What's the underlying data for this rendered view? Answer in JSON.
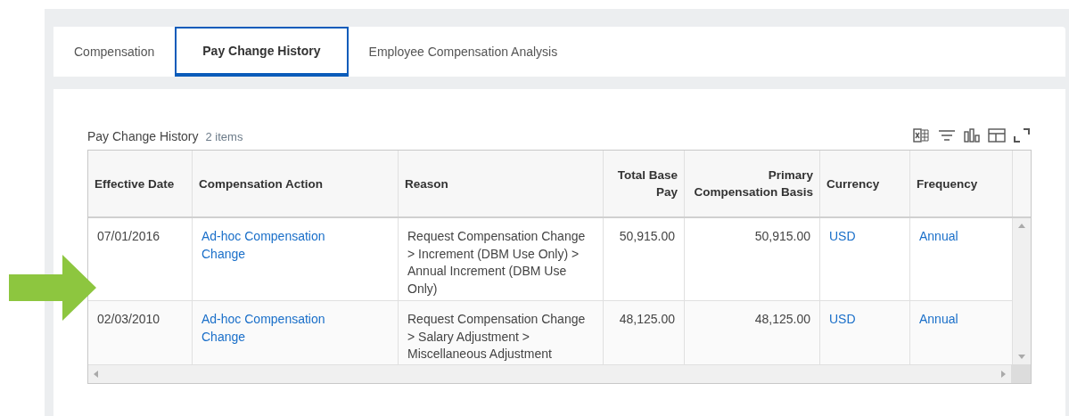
{
  "tabs": [
    {
      "label": "Compensation",
      "selected": false
    },
    {
      "label": "Pay Change History",
      "selected": true
    },
    {
      "label": "Employee Compensation Analysis",
      "selected": false
    }
  ],
  "grid": {
    "title": "Pay Change History",
    "count": "2 items",
    "columns": [
      {
        "label": "Effective Date",
        "kind": "text"
      },
      {
        "label": "Compensation Action",
        "kind": "link"
      },
      {
        "label": "Reason",
        "kind": "text"
      },
      {
        "label": "Total Base Pay",
        "kind": "number"
      },
      {
        "label": "Primary Compensation Basis",
        "kind": "number"
      },
      {
        "label": "Currency",
        "kind": "link"
      },
      {
        "label": "Frequency",
        "kind": "link"
      }
    ],
    "rows": [
      {
        "cells": [
          "07/01/2016",
          "Ad-hoc Compensation Change",
          "Request Compensation Change > Increment (DBM Use Only) > Annual Increment (DBM Use Only)",
          "50,915.00",
          "50,915.00",
          "USD",
          "Annual"
        ]
      },
      {
        "cells": [
          "02/03/2010",
          "Ad-hoc Compensation Change",
          "Request Compensation Change > Salary Adjustment > Miscellaneous Adjustment",
          "48,125.00",
          "48,125.00",
          "USD",
          "Annual"
        ]
      }
    ]
  }
}
